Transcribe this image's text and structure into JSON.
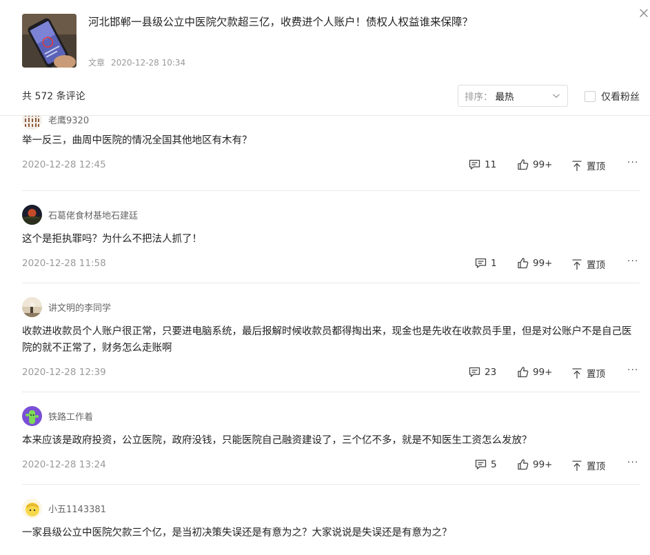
{
  "article": {
    "title": "河北邯郸一县级公立中医院欠款超三亿，收费进个人账户！债权人权益谁来保障？",
    "type": "文章",
    "datetime": "2020-12-28 10:34"
  },
  "toolbar": {
    "count_text": "共 572 条评论",
    "sort_label": "排序：",
    "sort_value": "最热",
    "fans_only_label": "仅看粉丝"
  },
  "icons": {
    "close": "close-icon",
    "chevron": "chevron-down-icon",
    "reply": "comment-bubble-icon",
    "like": "thumbs-up-icon",
    "pin": "pin-top-icon",
    "more": "more-dots-icon"
  },
  "comments": [
    {
      "username": "老鹰9320",
      "text": "举一反三，曲周中医院的情况全国其他地区有木有？",
      "date": "2020-12-28 12:45",
      "replies": "11",
      "likes": "99+",
      "pin_label": "置顶",
      "more": "···"
    },
    {
      "username": "石葛佬食材基地石建廷",
      "text": "这个是拒执罪吗？为什么不把法人抓了！",
      "date": "2020-12-28 11:58",
      "replies": "1",
      "likes": "99+",
      "pin_label": "置顶",
      "more": "···"
    },
    {
      "username": "讲文明的李同学",
      "text": "收款进收款员个人账户很正常，只要进电脑系统，最后报解时候收款员都得掏出来，现金也是先收在收款员手里，但是对公账户不是自己医院的就不正常了，财务怎么走账啊",
      "date": "2020-12-28 12:39",
      "replies": "23",
      "likes": "99+",
      "pin_label": "置顶",
      "more": "···"
    },
    {
      "username": "铁路工作着",
      "text": "本来应该是政府投资，公立医院，政府没钱，只能医院自己融资建设了，三个亿不多，就是不知医生工资怎么发放？",
      "date": "2020-12-28 13:24",
      "replies": "5",
      "likes": "99+",
      "pin_label": "置顶",
      "more": "···"
    },
    {
      "username": "小五1143381",
      "text": "一家县级公立中医院欠款三个亿，是当初决策失误还是有意为之？大家说说是失误还是有意为之？"
    }
  ],
  "colors": {
    "text_primary": "#222222",
    "text_secondary": "#666666",
    "text_muted": "#999999",
    "divider": "#e8e8e8"
  }
}
